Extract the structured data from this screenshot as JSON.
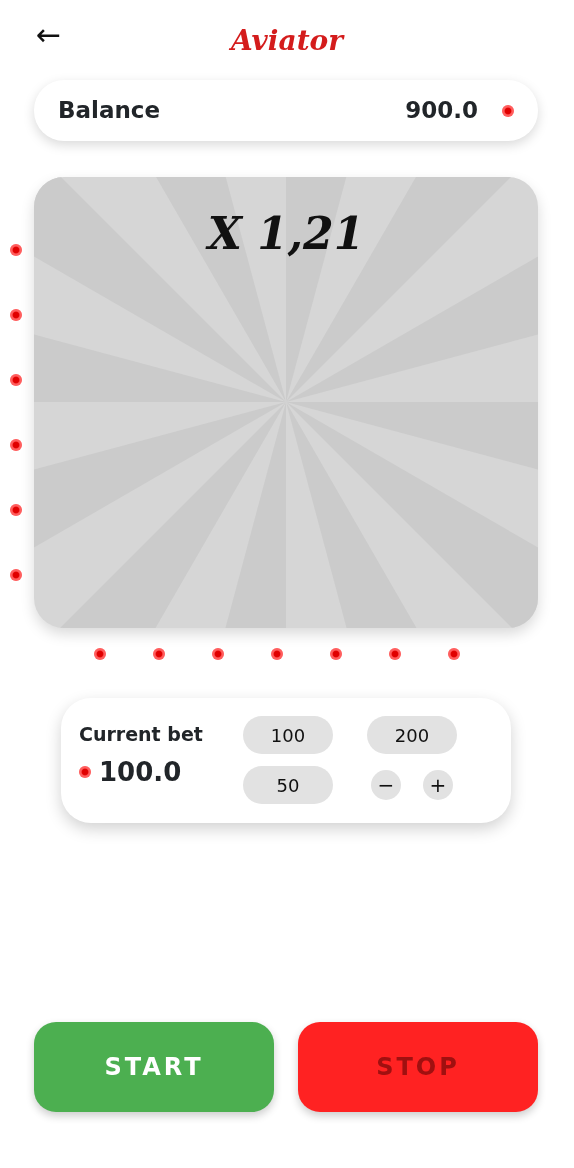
{
  "header": {
    "back": "←",
    "title": "Aviator"
  },
  "balance": {
    "label": "Balance",
    "value": "900.0"
  },
  "game": {
    "multiplier": "X 1,21"
  },
  "bet": {
    "label": "Current bet",
    "value": "100.0",
    "options": [
      {
        "label": "100",
        "kind": "chip"
      },
      {
        "label": "200",
        "kind": "chip"
      },
      {
        "label": "50",
        "kind": "chip"
      },
      {
        "label": "−",
        "kind": "round"
      },
      {
        "label": "+",
        "kind": "round"
      }
    ]
  },
  "actions": [
    {
      "label": "START",
      "color": "#4caf50",
      "disabled": false
    },
    {
      "label": "STOP",
      "color": "#ff2222",
      "disabled": true
    }
  ]
}
